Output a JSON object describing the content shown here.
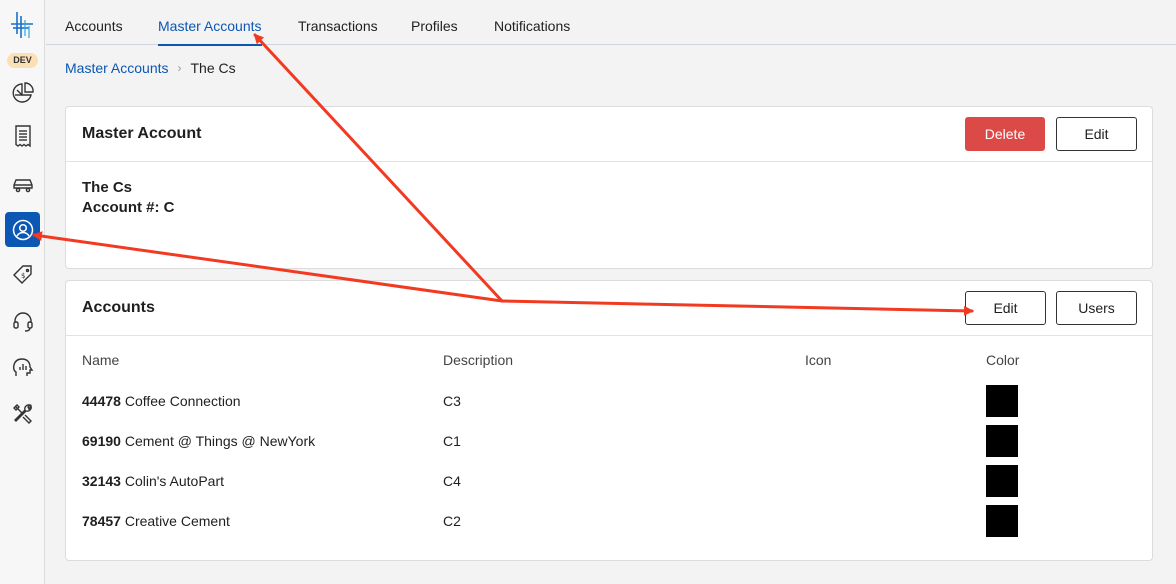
{
  "sidebar": {
    "badge": "DEV",
    "items": [
      {
        "icon": "pie-chart-icon"
      },
      {
        "icon": "receipt-icon"
      },
      {
        "icon": "car-icon"
      },
      {
        "icon": "user-circle-icon",
        "active": true
      },
      {
        "icon": "price-tag-icon"
      },
      {
        "icon": "headset-icon"
      },
      {
        "icon": "analytics-head-icon"
      },
      {
        "icon": "tools-icon"
      }
    ]
  },
  "topnav": {
    "tabs": [
      "Accounts",
      "Master Accounts",
      "Transactions",
      "Profiles",
      "Notifications"
    ],
    "active_tab": "Master Accounts"
  },
  "breadcrumb": {
    "link": "Master Accounts",
    "current": "The Cs"
  },
  "master_account": {
    "title": "Master Account",
    "delete_label": "Delete",
    "edit_label": "Edit",
    "name": "The Cs",
    "account_number": "Account #: C"
  },
  "accounts": {
    "title": "Accounts",
    "edit_label": "Edit",
    "users_label": "Users",
    "columns": [
      "Name",
      "Description",
      "Icon",
      "Color"
    ],
    "rows": [
      {
        "number": "44478",
        "name": "Coffee Connection",
        "description": "C3",
        "color": "#000000"
      },
      {
        "number": "69190",
        "name": "Cement @ Things @ NewYork",
        "description": "C1",
        "color": "#000000"
      },
      {
        "number": "32143",
        "name": "Colin's AutoPart",
        "description": "C4",
        "color": "#000000"
      },
      {
        "number": "78457",
        "name": "Creative Cement",
        "description": "C2",
        "color": "#000000"
      }
    ]
  },
  "colors": {
    "accent": "#0b57b3",
    "danger": "#dc4a47",
    "annotation": "#f23a22"
  }
}
